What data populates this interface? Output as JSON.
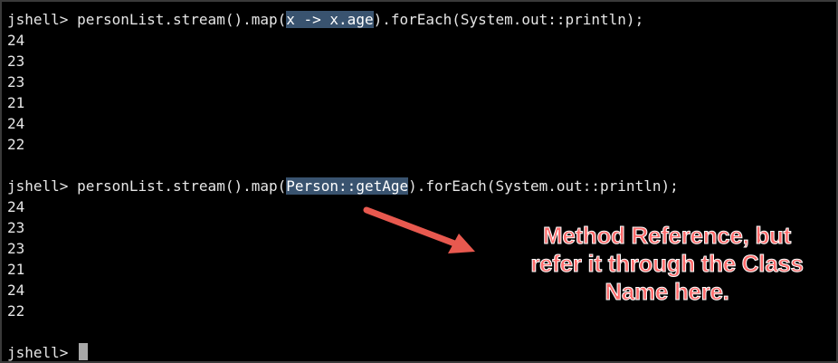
{
  "terminal": {
    "block1": {
      "prompt": "jshell> ",
      "cmd_before": "personList.stream().map(",
      "cmd_highlight": "x -> x.age",
      "cmd_after": ").forEach(System.out::println);",
      "output": [
        "24",
        "23",
        "23",
        "21",
        "24",
        "22"
      ]
    },
    "block2": {
      "prompt": "jshell> ",
      "cmd_before": "personList.stream().map(",
      "cmd_highlight": "Person::getAge",
      "cmd_after": ").forEach(System.out::println);",
      "output": [
        "24",
        "23",
        "23",
        "21",
        "24",
        "22"
      ]
    },
    "final_prompt": "jshell> "
  },
  "annotation": {
    "lines": [
      "Method Reference, but",
      "refer it through the Class",
      "Name here."
    ],
    "color": "#ff6b6b"
  },
  "colors": {
    "background": "#000000",
    "text": "#e6e6e6",
    "highlight": "#39536f",
    "arrow": "#e8594f"
  }
}
